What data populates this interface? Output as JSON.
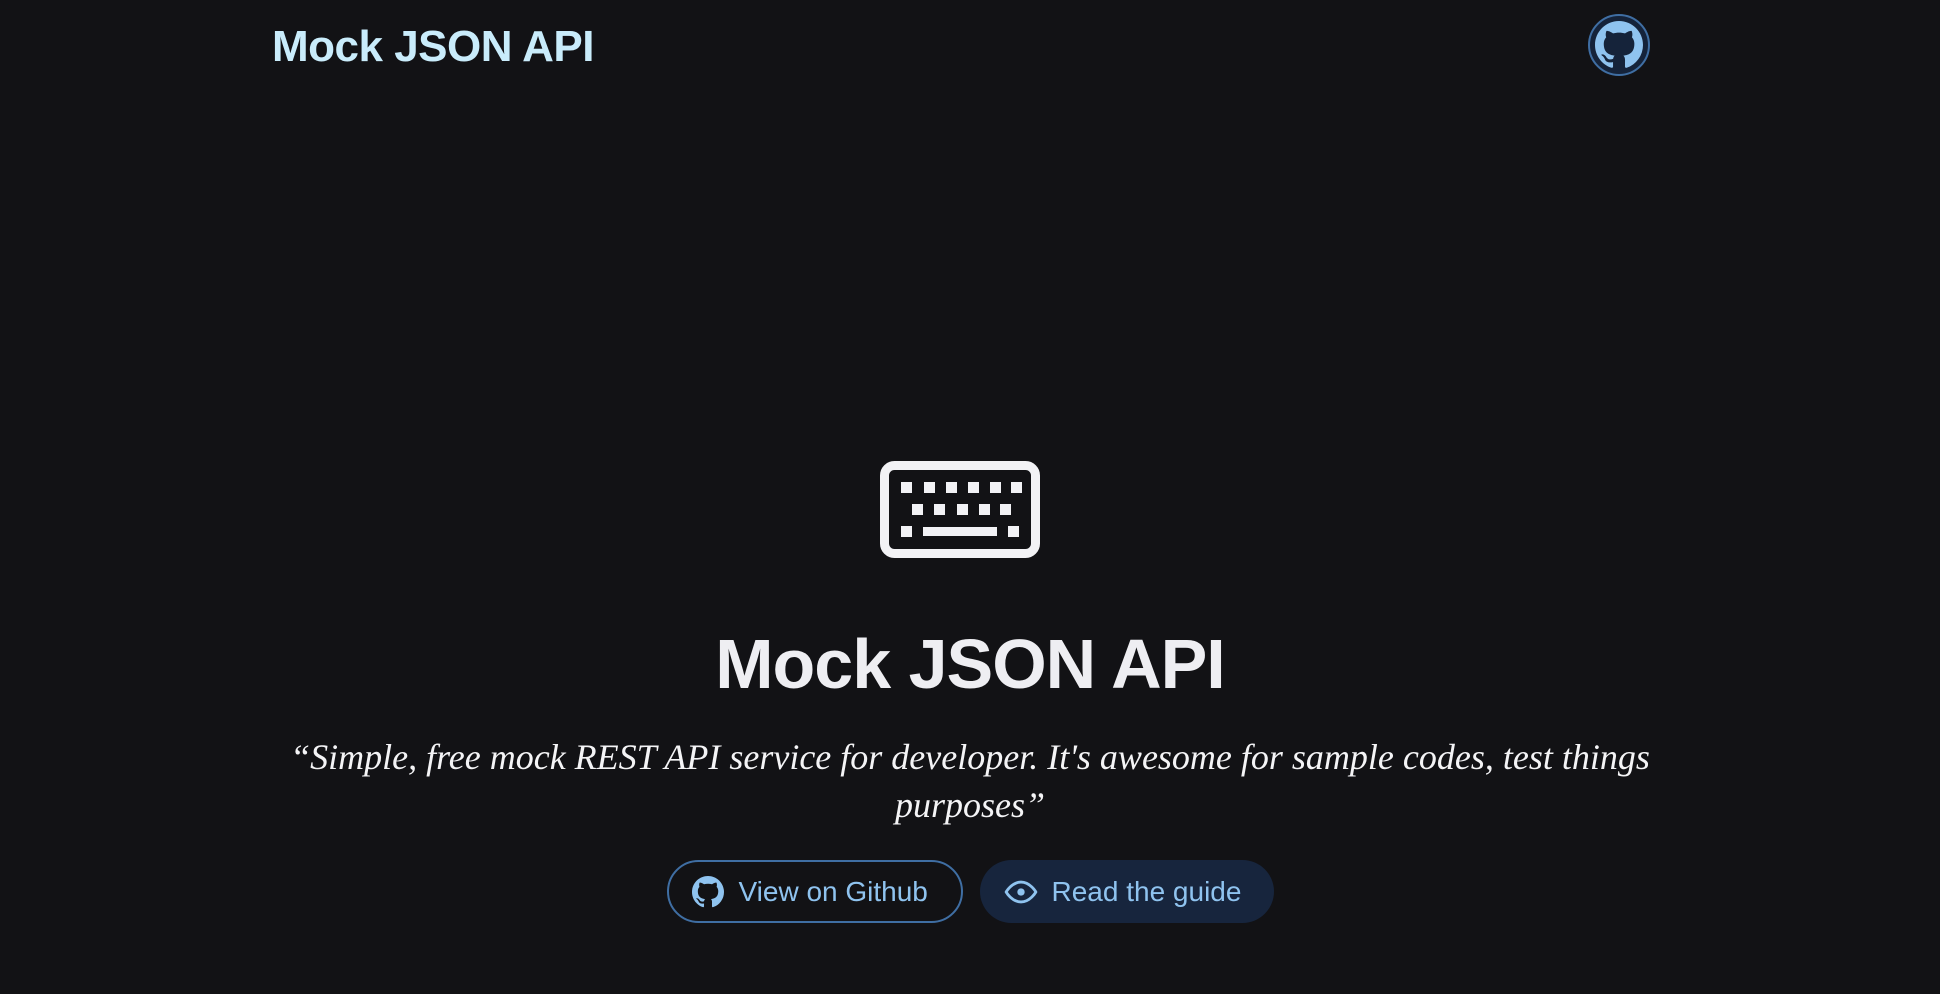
{
  "header": {
    "brand": "Mock JSON API",
    "github_icon": "github-icon"
  },
  "hero": {
    "icon": "keyboard-icon",
    "title": "Mock JSON API",
    "quote": "“Simple, free mock REST API service for developer. It's awesome for sample codes, test things purposes”"
  },
  "actions": {
    "github_label": "View on Github",
    "github_icon": "github-icon",
    "guide_label": "Read the guide",
    "guide_icon": "eye-icon"
  },
  "colors": {
    "background": "#121215",
    "brand": "#c9ecfb",
    "accent": "#8fc3ef",
    "button_border": "#3f6ea3",
    "button_fill": "#17253d"
  }
}
